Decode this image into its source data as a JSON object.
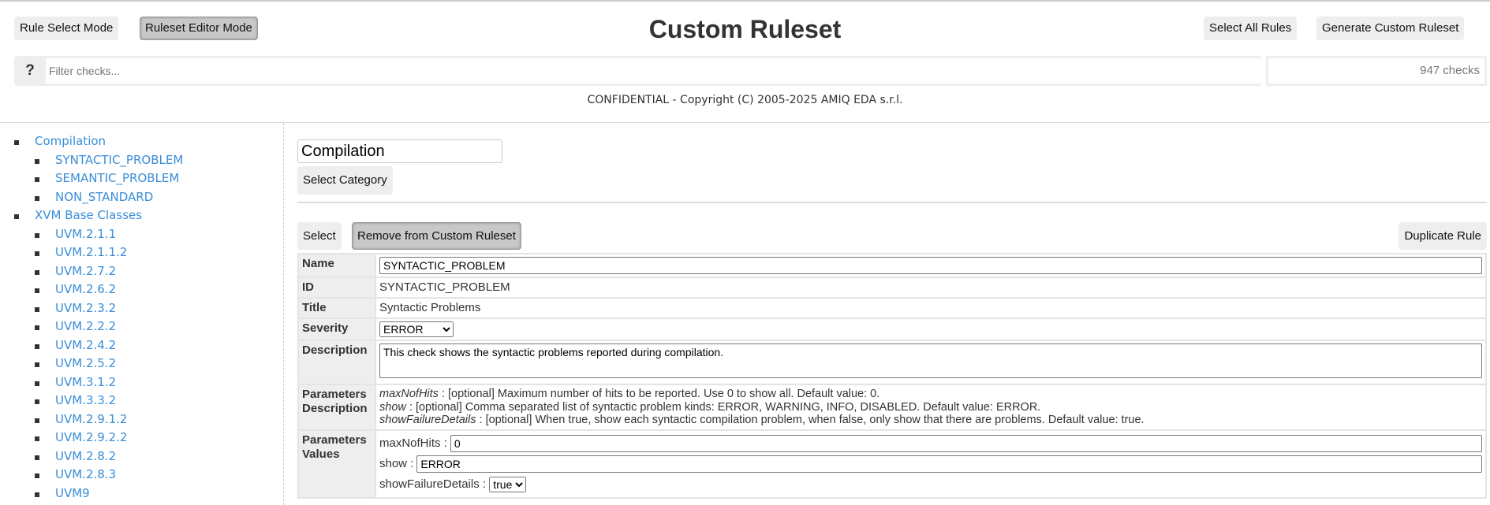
{
  "header": {
    "title": "Custom Ruleset",
    "mode_buttons": [
      "Rule Select Mode",
      "Ruleset Editor Mode"
    ],
    "active_mode": "Ruleset Editor Mode",
    "select_all": "Select All Rules",
    "generate": "Generate Custom Ruleset"
  },
  "filter": {
    "help": "?",
    "placeholder": "Filter checks...",
    "count": "947 checks"
  },
  "copyright": "CONFIDENTIAL - Copyright (C) 2005-2025 AMIQ EDA s.r.l.",
  "sidebar": {
    "items": [
      {
        "label": "Compilation",
        "level": 0
      },
      {
        "label": "SYNTACTIC_PROBLEM",
        "level": 1
      },
      {
        "label": "SEMANTIC_PROBLEM",
        "level": 1
      },
      {
        "label": "NON_STANDARD",
        "level": 1
      },
      {
        "label": "XVM Base Classes",
        "level": 0
      },
      {
        "label": "UVM.2.1.1",
        "level": 1
      },
      {
        "label": "UVM.2.1.1.2",
        "level": 1
      },
      {
        "label": "UVM.2.7.2",
        "level": 1
      },
      {
        "label": "UVM.2.6.2",
        "level": 1
      },
      {
        "label": "UVM.2.3.2",
        "level": 1
      },
      {
        "label": "UVM.2.2.2",
        "level": 1
      },
      {
        "label": "UVM.2.4.2",
        "level": 1
      },
      {
        "label": "UVM.2.5.2",
        "level": 1
      },
      {
        "label": "UVM.3.1.2",
        "level": 1
      },
      {
        "label": "UVM.3.3.2",
        "level": 1
      },
      {
        "label": "UVM.2.9.1.2",
        "level": 1
      },
      {
        "label": "UVM.2.9.2.2",
        "level": 1
      },
      {
        "label": "UVM.2.8.2",
        "level": 1
      },
      {
        "label": "UVM.2.8.3",
        "level": 1
      },
      {
        "label": "UVM9",
        "level": 1
      }
    ]
  },
  "category": {
    "value": "Compilation",
    "select_label": "Select Category"
  },
  "rule": {
    "select": "Select",
    "remove": "Remove from Custom Ruleset",
    "duplicate": "Duplicate Rule",
    "labels": {
      "name": "Name",
      "id": "ID",
      "title": "Title",
      "severity": "Severity",
      "description": "Description",
      "params_desc": "Parameters Description",
      "params_values": "Parameters Values"
    },
    "name": "SYNTACTIC_PROBLEM",
    "id": "SYNTACTIC_PROBLEM",
    "title": "Syntactic Problems",
    "severity": "ERROR",
    "description": "This check shows the syntactic problems reported during compilation.",
    "params": [
      {
        "name": "maxNofHits",
        "desc": " : [optional] Maximum number of hits to be reported. Use 0 to show all. Default value: 0.",
        "label": "maxNofHits :",
        "value": "0"
      },
      {
        "name": "show",
        "desc": " : [optional] Comma separated list of syntactic problem kinds: ERROR, WARNING, INFO, DISABLED. Default value: ERROR.",
        "label": "show :",
        "value": "ERROR"
      },
      {
        "name": "showFailureDetails",
        "desc": " : [optional] When true, show each syntactic compilation problem, when false, only show that there are problems. Default value: true.",
        "label": "showFailureDetails :",
        "value": "true"
      }
    ]
  }
}
